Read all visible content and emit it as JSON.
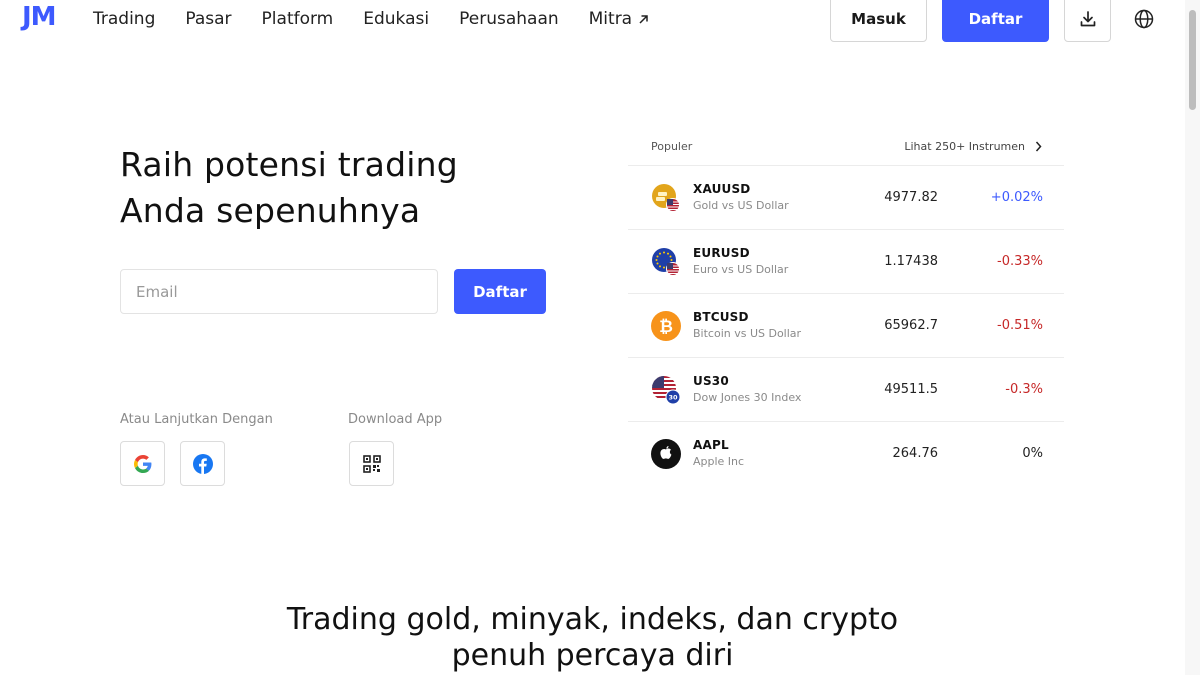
{
  "nav": {
    "logo": "JM",
    "items": [
      {
        "label": "Trading"
      },
      {
        "label": "Pasar"
      },
      {
        "label": "Platform"
      },
      {
        "label": "Edukasi"
      },
      {
        "label": "Perusahaan"
      },
      {
        "label": "Mitra",
        "icon": "external-arrow-icon"
      }
    ],
    "login_label": "Masuk",
    "register_label": "Daftar",
    "download_icon": "download-icon",
    "language_icon": "globe-icon"
  },
  "hero": {
    "title_line1": "Raih potensi trading",
    "title_line2": "Anda sepenuhnya",
    "email_placeholder": "Email",
    "register_label": "Daftar",
    "social_label": "Atau Lanjutkan Dengan",
    "download_label": "Download App"
  },
  "market": {
    "header_left": "Populer",
    "header_right": "Lihat 250+ Instrumen",
    "rows": [
      {
        "symbol": "XAUUSD",
        "desc": "Gold vs US Dollar",
        "price": "4977.82",
        "change": "+0.02%",
        "trend": "up",
        "icon": "gold-icon"
      },
      {
        "symbol": "EURUSD",
        "desc": "Euro vs US Dollar",
        "price": "1.17438",
        "change": "-0.33%",
        "trend": "down",
        "icon": "eu-flag-icon"
      },
      {
        "symbol": "BTCUSD",
        "desc": "Bitcoin vs US Dollar",
        "price": "65962.7",
        "change": "-0.51%",
        "trend": "down",
        "icon": "bitcoin-icon"
      },
      {
        "symbol": "US30",
        "desc": "Dow Jones 30 Index",
        "price": "49511.5",
        "change": "-0.3%",
        "trend": "down",
        "icon": "us-flag-icon"
      },
      {
        "symbol": "AAPL",
        "desc": "Apple Inc",
        "price": "264.76",
        "change": "0%",
        "trend": "flat",
        "icon": "apple-icon"
      }
    ]
  },
  "bottom": {
    "line1": "Trading gold, minyak, indeks, dan crypto",
    "line2": "penuh percaya diri"
  },
  "colors": {
    "brand": "#3d5afe",
    "up": "#3d5afe",
    "down": "#c62828",
    "flat": "#222222"
  }
}
